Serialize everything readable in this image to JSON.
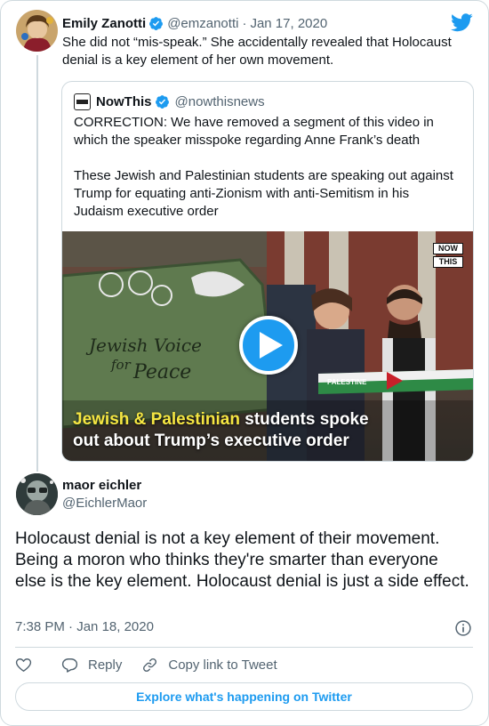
{
  "colors": {
    "accent": "#1d9bf0",
    "text": "#0f1419",
    "secondary_text": "#536471",
    "border": "#cfd9de",
    "caption_highlight": "#f5e642"
  },
  "header": {
    "brand_icon": "twitter-bird-icon"
  },
  "parent_tweet": {
    "author_name": "Emily Zanotti",
    "verified_icon": "verified-badge-icon",
    "handle": "@emzanotti",
    "separator": "·",
    "date": "Jan 17, 2020",
    "text": "She did not “mis-speak.” She accidentally revealed that Holocaust denial is a key element of her own movement."
  },
  "quoted_tweet": {
    "author_name": "NowThis",
    "handle": "@nowthisnews",
    "paragraph_1": "CORRECTION: We have removed a segment of this video in which the speaker misspoke regarding Anne Frank’s death",
    "paragraph_2": "These Jewish and Palestinian students are speaking out against Trump for equating anti-Zionism with anti-Semitism in his Judaism executive order",
    "video": {
      "watermark_line_1": "NOW",
      "watermark_line_2": "THIS",
      "banner_text_1": "Jewish Voice",
      "banner_text_2": "for",
      "banner_text_3": "Peace",
      "scarf_text": "PALESTINE",
      "caption_highlight": "Jewish & Palestinian",
      "caption_rest_line_1": " students spoke",
      "caption_line_2": "out about Trump’s executive order",
      "play_icon": "play-icon"
    }
  },
  "reply_tweet": {
    "author_name": "maor eichler",
    "handle": "@EichlerMaor",
    "text": "Holocaust denial is not a key element of their movement. Being a moron who thinks they're smarter than everyone else is the key element. Holocaust denial is just a side effect.",
    "time": "7:38 PM",
    "separator": "·",
    "date": "Jan 18, 2020",
    "info_icon": "info-icon"
  },
  "actions": {
    "like_icon": "heart-icon",
    "reply_icon": "reply-bubble-icon",
    "reply_label": "Reply",
    "link_icon": "link-icon",
    "copy_link_label": "Copy link to Tweet"
  },
  "footer": {
    "explore_label": "Explore what's happening on Twitter"
  }
}
